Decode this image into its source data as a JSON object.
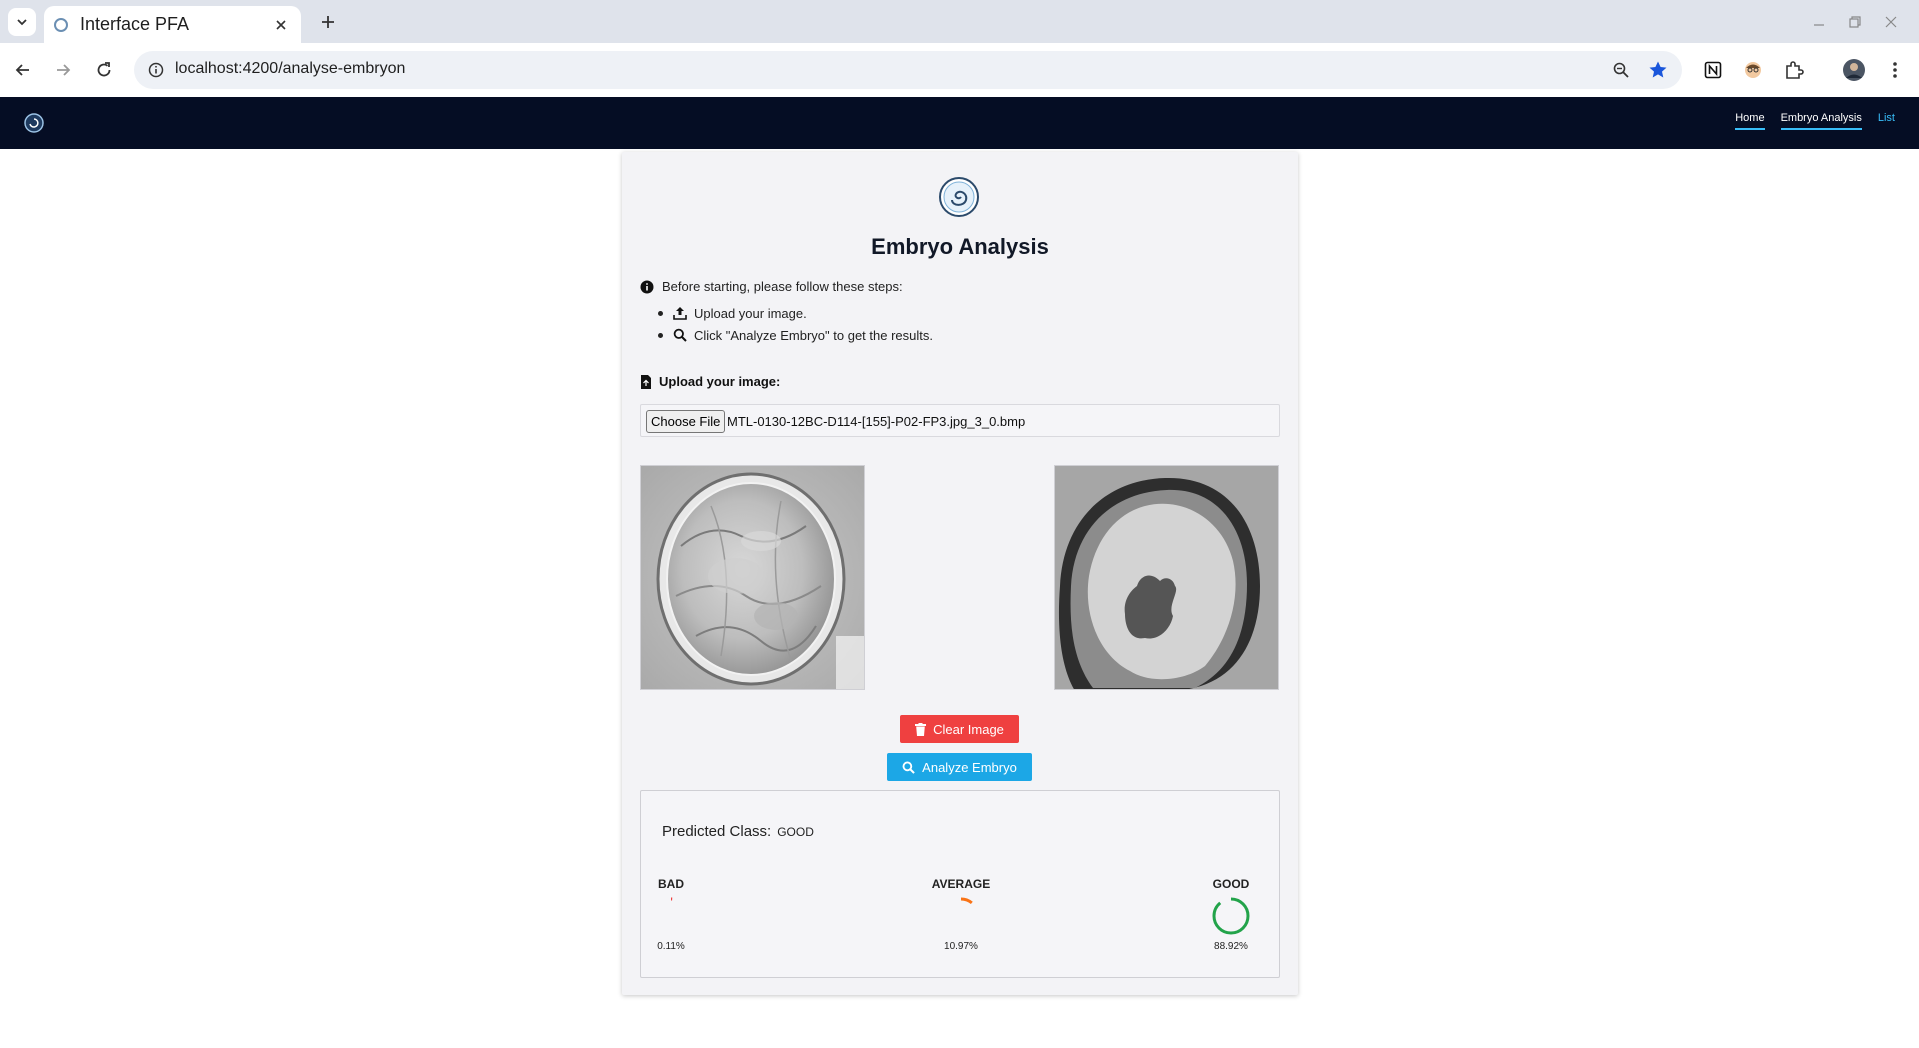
{
  "browser": {
    "tab_title": "Interface PFA",
    "url": "localhost:4200/analyse-embryon"
  },
  "navbar": {
    "links": [
      {
        "label": "Home"
      },
      {
        "label": "Embryo Analysis"
      },
      {
        "label": "List"
      }
    ]
  },
  "page": {
    "title": "Embryo Analysis",
    "intro": "Before starting, please follow these steps:",
    "steps": [
      "Upload your image.",
      "Click \"Analyze Embryo\" to get the results."
    ],
    "upload_label": "Upload your image:",
    "choose_file_label": "Choose File",
    "file_name": "MTL-0130-12BC-D114-[155]-P02-FP3.jpg_3_0.bmp",
    "clear_button": "Clear Image",
    "analyze_button": "Analyze Embryo"
  },
  "results": {
    "predicted_label": "Predicted Class:",
    "predicted_value": "GOOD",
    "gauges": [
      {
        "label": "BAD",
        "value": 0.11,
        "display": "0.11%",
        "color": "#ef4040"
      },
      {
        "label": "AVERAGE",
        "value": 10.97,
        "display": "10.97%",
        "color": "#f97316"
      },
      {
        "label": "GOOD",
        "value": 88.92,
        "display": "88.92%",
        "color": "#22a34a"
      }
    ]
  },
  "colors": {
    "navbar_bg": "#050d24",
    "accent": "#38bdf8",
    "clear_button": "#ef4040",
    "analyze_button": "#1ca7e6"
  }
}
